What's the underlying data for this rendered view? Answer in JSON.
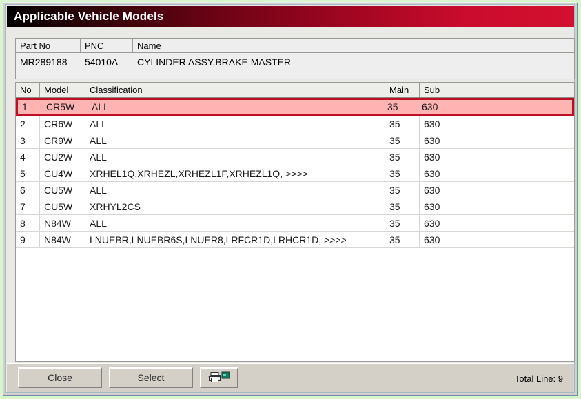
{
  "window": {
    "title": "Applicable Vehicle Models"
  },
  "part_info": {
    "headers": [
      "Part No",
      "PNC",
      "Name"
    ],
    "part_no": "MR289188",
    "pnc": "54010A",
    "name": "CYLINDER ASSY,BRAKE MASTER"
  },
  "grid": {
    "headers": {
      "no": "No",
      "model": "Model",
      "classification": "Classification",
      "main": "Main",
      "sub": "Sub"
    },
    "rows": [
      {
        "no": "1",
        "model": "CR5W",
        "classification": "ALL",
        "main": "35",
        "sub": "630",
        "selected": true
      },
      {
        "no": "2",
        "model": "CR6W",
        "classification": "ALL",
        "main": "35",
        "sub": "630",
        "selected": false
      },
      {
        "no": "3",
        "model": "CR9W",
        "classification": "ALL",
        "main": "35",
        "sub": "630",
        "selected": false
      },
      {
        "no": "4",
        "model": "CU2W",
        "classification": "ALL",
        "main": "35",
        "sub": "630",
        "selected": false
      },
      {
        "no": "5",
        "model": "CU4W",
        "classification": "XRHEL1Q,XRHEZL,XRHEZL1F,XRHEZL1Q,  >>>>",
        "main": "35",
        "sub": "630",
        "selected": false
      },
      {
        "no": "6",
        "model": "CU5W",
        "classification": "ALL",
        "main": "35",
        "sub": "630",
        "selected": false
      },
      {
        "no": "7",
        "model": "CU5W",
        "classification": "XRHYL2CS",
        "main": "35",
        "sub": "630",
        "selected": false
      },
      {
        "no": "8",
        "model": "N84W",
        "classification": "ALL",
        "main": "35",
        "sub": "630",
        "selected": false
      },
      {
        "no": "9",
        "model": "N84W",
        "classification": "LNUEBR,LNUEBR6S,LNUER8,LRFCR1D,LRHCR1D,  >>>>",
        "main": "35",
        "sub": "630",
        "selected": false
      }
    ]
  },
  "footer": {
    "close_label": "Close",
    "select_label": "Select",
    "print_icon": "printer-icon",
    "total_line": "Total Line: 9"
  },
  "colors": {
    "title_gradient_start": "#000000",
    "title_gradient_end": "#d2102f",
    "selected_row_fill": "#ffb3b3",
    "selected_row_border": "#bb1122",
    "window_face": "#d4d0c8",
    "desktop": "#d9f5cd"
  }
}
